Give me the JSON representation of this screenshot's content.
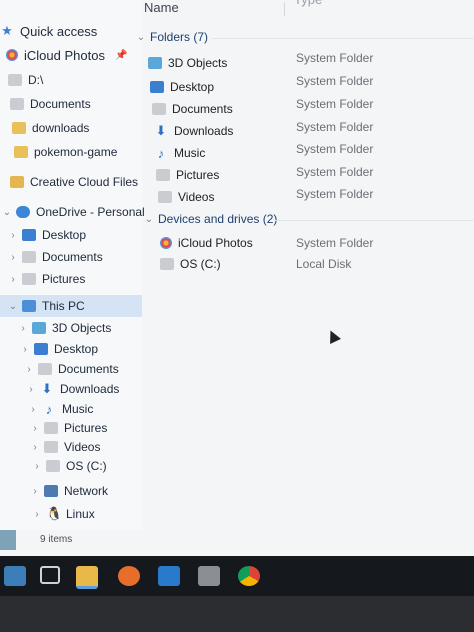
{
  "columns": {
    "name": "Name",
    "type": "Type"
  },
  "nav": {
    "quick_access": "Quick access",
    "items": [
      {
        "label": "iCloud Photos",
        "pinned": true
      },
      {
        "label": "D:\\"
      },
      {
        "label": "Documents"
      },
      {
        "label": "downloads"
      },
      {
        "label": "pokemon-game"
      },
      {
        "label": "Creative Cloud Files"
      },
      {
        "label": "OneDrive - Personal"
      },
      {
        "label": "Desktop"
      },
      {
        "label": "Documents"
      },
      {
        "label": "Pictures"
      },
      {
        "label": "This PC"
      },
      {
        "label": "3D Objects"
      },
      {
        "label": "Desktop"
      },
      {
        "label": "Documents"
      },
      {
        "label": "Downloads"
      },
      {
        "label": "Music"
      },
      {
        "label": "Pictures"
      },
      {
        "label": "Videos"
      },
      {
        "label": "OS (C:)"
      },
      {
        "label": "Network"
      },
      {
        "label": "Linux"
      }
    ]
  },
  "status_bar": {
    "count": "9 items"
  },
  "groups": {
    "folders": {
      "header": "Folders (7)",
      "items": [
        {
          "name": "3D Objects",
          "type": "System Folder"
        },
        {
          "name": "Desktop",
          "type": "System Folder"
        },
        {
          "name": "Documents",
          "type": "System Folder"
        },
        {
          "name": "Downloads",
          "type": "System Folder"
        },
        {
          "name": "Music",
          "type": "System Folder"
        },
        {
          "name": "Pictures",
          "type": "System Folder"
        },
        {
          "name": "Videos",
          "type": "System Folder"
        }
      ]
    },
    "devices": {
      "header": "Devices and drives (2)",
      "items": [
        {
          "name": "iCloud Photos",
          "type": "System Folder"
        },
        {
          "name": "OS (C:)",
          "type": "Local Disk"
        }
      ]
    }
  },
  "colors": {
    "selection": "#d5e4f5",
    "accent": "#3b7fd1",
    "taskbar": "#15181d"
  },
  "taskbar_icons": [
    "whale-icon",
    "task-view-icon",
    "file-explorer-icon",
    "firefox-icon",
    "vscode-icon",
    "app-icon",
    "chrome-icon"
  ]
}
